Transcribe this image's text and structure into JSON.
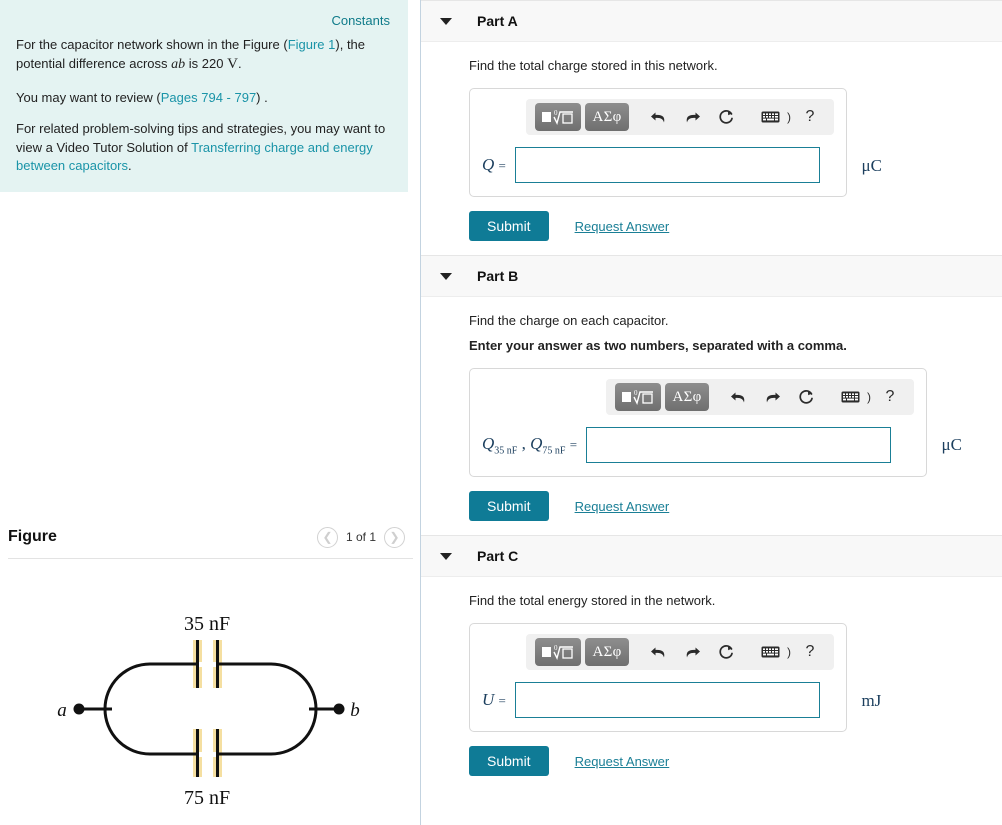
{
  "theme": {
    "accent_teal": "#0f7b96",
    "link_teal": "#1a94a8",
    "info_bg": "#e4f3f2",
    "part_head_bg": "#f8f8f8",
    "capacitor_plate": "#f5dfa0"
  },
  "sidebar": {
    "constants_label": "Constants",
    "paragraph1": {
      "pre": "For the capacitor network shown in the Figure (",
      "link": "Figure 1",
      "mid": "), the potential difference across ",
      "var": "ab",
      "mid2": " is ",
      "value": "220",
      "unit": "V",
      "post": "."
    },
    "paragraph2": {
      "pre": "You may want to review (",
      "link": "Pages 794 - 797",
      "post": ") ."
    },
    "paragraph3": {
      "pre": "For related problem-solving tips and strategies, you may want to view a Video Tutor Solution of ",
      "link": "Transferring charge and energy between capacitors",
      "post": "."
    }
  },
  "figure": {
    "title": "Figure",
    "prev_icon": "chevron-left-icon",
    "next_icon": "chevron-right-icon",
    "counter": "1 of 1",
    "diagram": {
      "top_capacitor_label": "35 nF",
      "bottom_capacitor_label": "75 nF",
      "left_terminal_label": "a",
      "right_terminal_label": "b"
    }
  },
  "toolbar": {
    "template_button_label": "math-template",
    "greek_button_label": "ΑΣφ",
    "undo_icon": "undo-arrow-icon",
    "redo_icon": "redo-arrow-icon",
    "reset_icon": "reset-circular-arrow-icon",
    "keyboard_icon": "keyboard-icon",
    "keyboard_paren": ")",
    "help_label": "?"
  },
  "parts": [
    {
      "id": "part-a",
      "label": "Part A",
      "prompt": "Find the total charge stored in this network.",
      "prompt_bold": "",
      "var_html": "Q",
      "var_plain": "Q =",
      "unit": "μC",
      "input_value": "",
      "input_placeholder": "",
      "input_width": 305,
      "submit_label": "Submit",
      "request_label": "Request Answer"
    },
    {
      "id": "part-b",
      "label": "Part B",
      "prompt": "Find the charge on each capacitor.",
      "prompt_bold": "Enter your answer as two numbers, separated with a comma.",
      "var_plain": "Q35 nF , Q75 nF =",
      "sub1": "35 nF",
      "sub2": "75 nF",
      "unit": "μC",
      "input_value": "",
      "input_placeholder": "",
      "input_width": 305,
      "submit_label": "Submit",
      "request_label": "Request Answer"
    },
    {
      "id": "part-c",
      "label": "Part C",
      "prompt": "Find the total energy stored in the network.",
      "prompt_bold": "",
      "var_plain": "U =",
      "unit": "mJ",
      "input_value": "",
      "input_placeholder": "",
      "input_width": 305,
      "submit_label": "Submit",
      "request_label": "Request Answer"
    }
  ]
}
